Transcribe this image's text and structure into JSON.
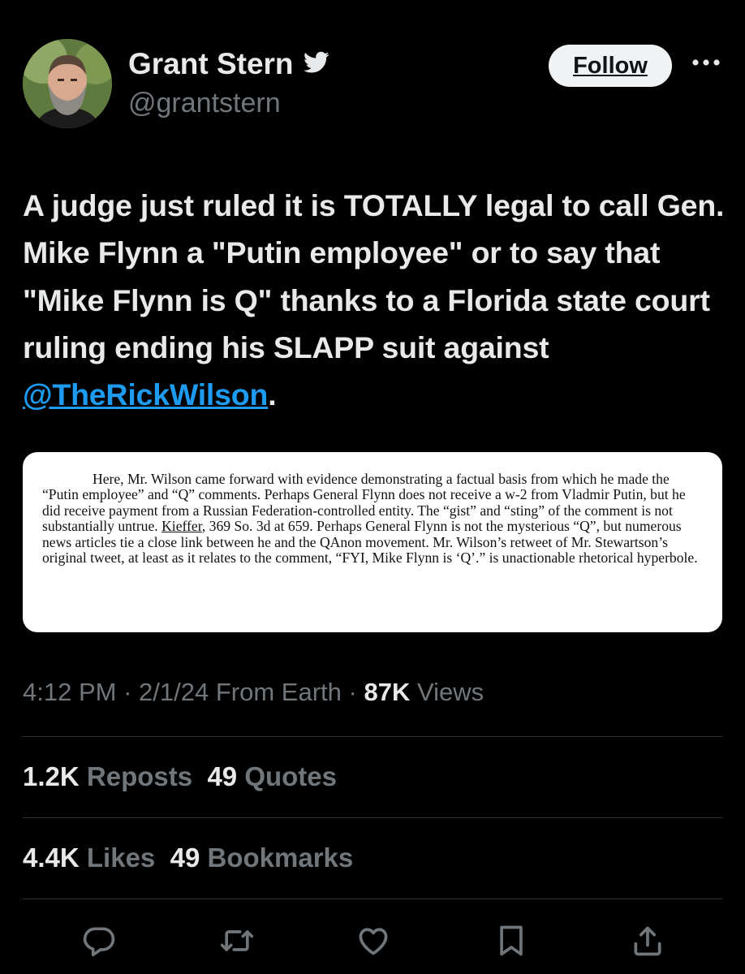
{
  "author": {
    "name": "Grant Stern",
    "handle": "@grantstern",
    "verified_icon": "twitter-bird-icon"
  },
  "header": {
    "follow_label": "Follow",
    "more_icon": "more-horizontal-icon"
  },
  "tweet": {
    "text_before": "A judge just ruled it is TOTALLY legal to call Gen. Mike Flynn a \"Putin employee\" or to say that \"Mike Flynn is Q\" thanks to a Florida state court ruling ending his SLAPP suit against ",
    "mention": "@TheRickWilson",
    "text_after": "."
  },
  "document": {
    "part1": "Here, Mr. Wilson came forward with evidence demonstrating a factual basis from which he made the “Putin employee” and “Q” comments. Perhaps General Flynn does not receive a w-2 from Vladmir Putin, but he did receive payment from a Russian Federation-controlled entity. The “gist” and “sting” of the comment is not substantially untrue. ",
    "citation": "Kieffer",
    "part2": ", 369 So. 3d at 659. Perhaps General Flynn is not the mysterious “Q”, but numerous news articles tie a close link between he and the QAnon movement. Mr. Wilson’s retweet of Mr. Stewartson’s original tweet, at least as it relates to the comment, “FYI, Mike Flynn is ‘Q’.” is unactionable rhetorical hyperbole."
  },
  "meta": {
    "time": "4:12 PM",
    "date": "2/1/24",
    "source": "From Earth",
    "sep": "·",
    "views_count": "87K",
    "views_label": "Views"
  },
  "stats": {
    "reposts_count": "1.2K",
    "reposts_label": "Reposts",
    "quotes_count": "49",
    "quotes_label": "Quotes",
    "likes_count": "4.4K",
    "likes_label": "Likes",
    "bookmarks_count": "49",
    "bookmarks_label": "Bookmarks"
  },
  "actions": [
    "reply-icon",
    "repost-icon",
    "like-icon",
    "bookmark-icon",
    "share-icon"
  ],
  "colors": {
    "background": "#000000",
    "text": "#e7e9ea",
    "secondary": "#71767b",
    "link": "#1d9bf0",
    "divider": "#2f3336"
  }
}
